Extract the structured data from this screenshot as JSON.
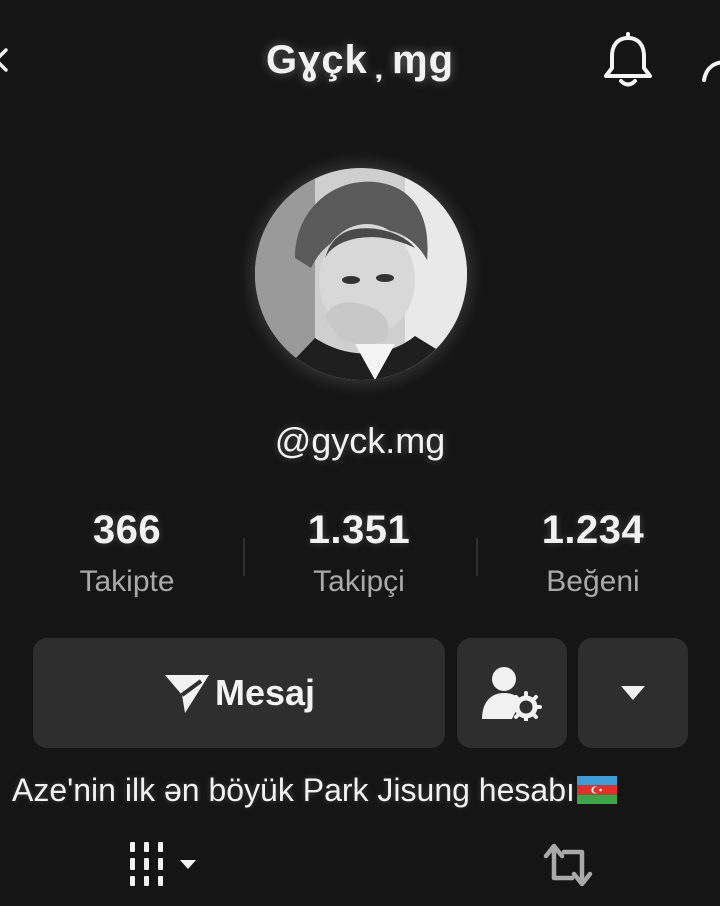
{
  "header": {
    "title": "Gɣçk ̦ ɱg"
  },
  "profile": {
    "username": "@gyck.mg",
    "bio": "Aze'nin ilk ən böyük Park Jisung hesabı"
  },
  "stats": [
    {
      "value": "366",
      "label": "Takipte"
    },
    {
      "value": "1.351",
      "label": "Takipçi"
    },
    {
      "value": "1.234",
      "label": "Beğeni"
    }
  ],
  "actions": {
    "message_label": "Mesaj"
  },
  "tabs": [
    {
      "icon": "grid-icon"
    },
    {
      "icon": "repost-icon"
    }
  ],
  "colors": {
    "background": "#151515",
    "button": "#2e2e2e",
    "text": "#f2f2f2",
    "muted": "#a9a9a9"
  }
}
